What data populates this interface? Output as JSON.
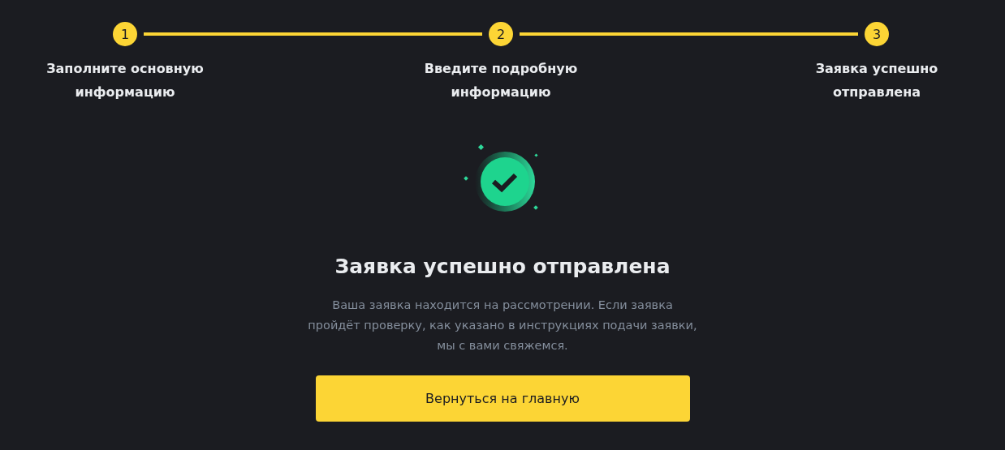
{
  "steps": [
    {
      "number": "1",
      "label": "Заполните основную информацию",
      "completed": true
    },
    {
      "number": "2",
      "label": "Введите подробную информацию",
      "completed": true
    },
    {
      "number": "3",
      "label": "Заявка успешно отправлена",
      "completed": true
    }
  ],
  "result": {
    "title": "Заявка успешно отправлена",
    "message": "Ваша заявка находится на рассмотрении. Если заявка пройдёт проверку, как указано в инструкциях подачи заявки, мы с вами свяжемся.",
    "button": "Вернуться на главную"
  }
}
